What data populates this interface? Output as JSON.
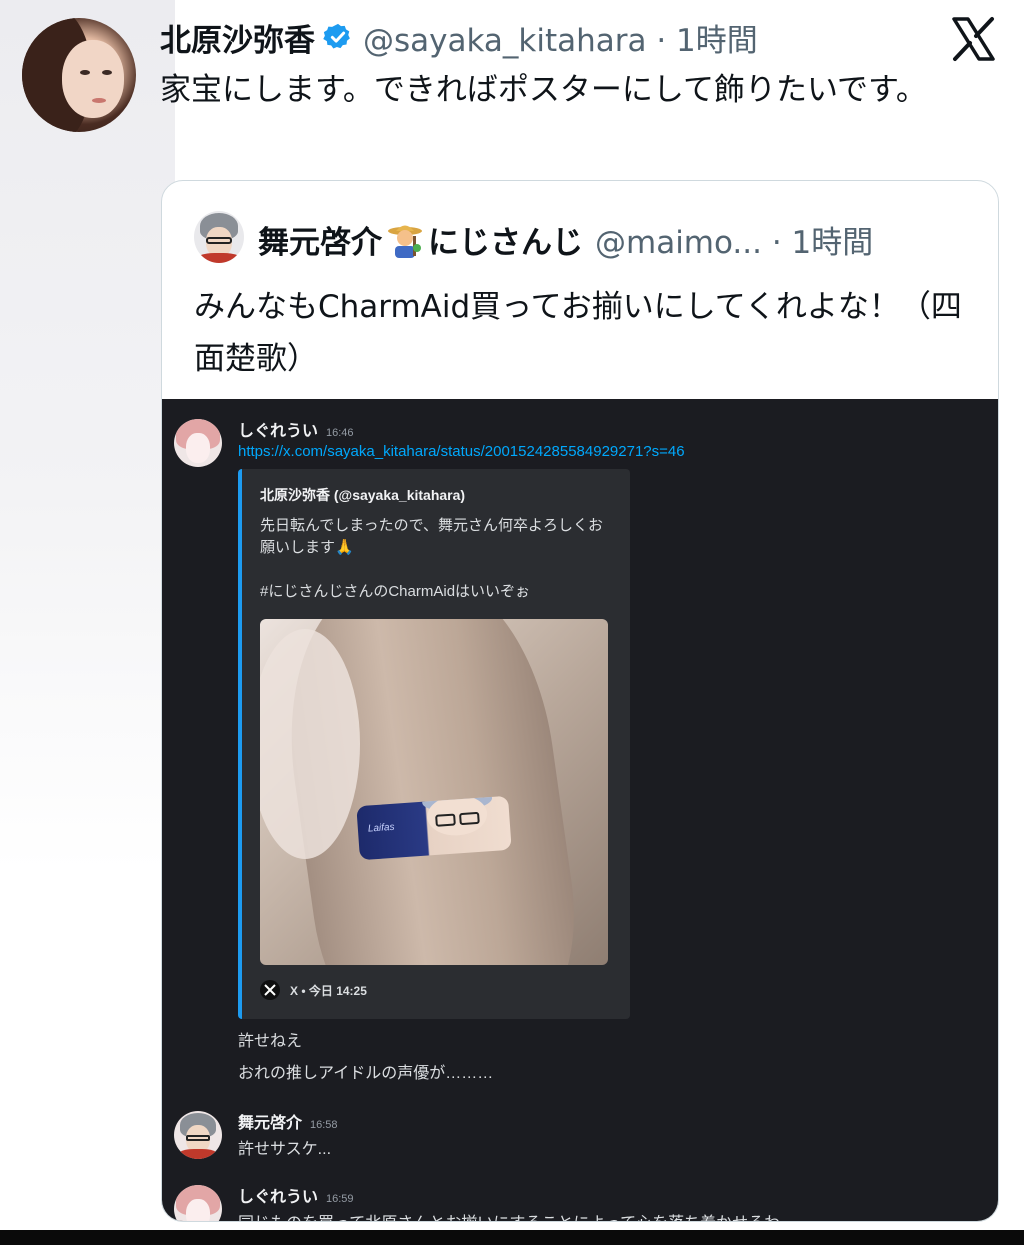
{
  "post": {
    "display_name": "北原沙弥香",
    "handle_time": "@sayaka_kitahara · 1時間",
    "text": "家宝にします。できればポスターにして飾りたいです。"
  },
  "quote": {
    "display_name_a": "舞元啓介",
    "display_name_b": "にじさんじ",
    "handle_time": "@maimo... · 1時間",
    "text": "みんなもCharmAid買ってお揃いにしてくれよな！（四面楚歌）",
    "discord": {
      "msg1": {
        "user": "しぐれうい",
        "time": "16:46",
        "link": "https://x.com/sayaka_kitahara/status/2001524285584929271?s=46",
        "embed": {
          "author": "北原沙弥香 (@sayaka_kitahara)",
          "description": "先日転んでしまったので、舞元さん何卒よろしくお願いします🙏\n\n#にじさんじさんのCharmAidはいいぞぉ",
          "footer": "X • 今日 14:25"
        },
        "line1": "許せねえ",
        "line2": "おれの推しアイドルの声優が………"
      },
      "msg2": {
        "user": "舞元啓介",
        "time": "16:58",
        "text": "許せサスケ..."
      },
      "msg3": {
        "user": "しぐれうい",
        "time": "16:59",
        "text": "同じものを買って北原さんとお揃いにすることによって心を落ち着かせるわ"
      }
    }
  },
  "colors": {
    "verified": "#1d9bf0",
    "link": "#00a8fc",
    "discord_bg": "#1b1c21"
  },
  "icons": [
    "verified-badge-icon",
    "x-logo-icon",
    "farmer-emoji-icon"
  ]
}
